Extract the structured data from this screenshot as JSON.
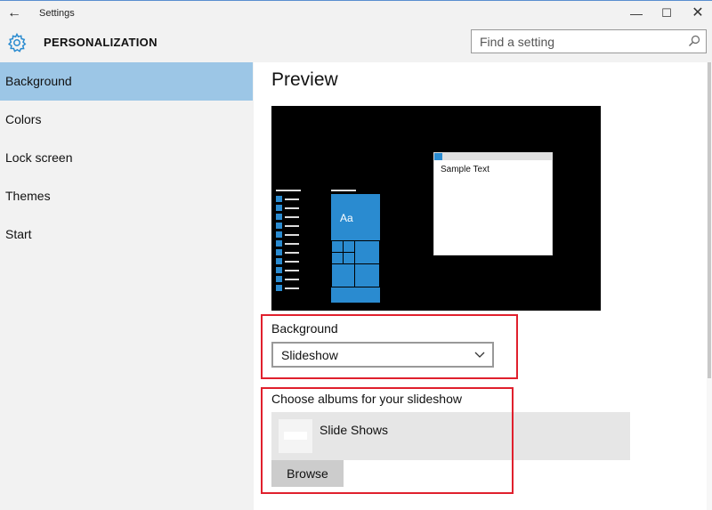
{
  "window": {
    "title": "Settings",
    "back_glyph": "←",
    "minimize_glyph": "—",
    "maximize_glyph": "☐",
    "close_glyph": "✕"
  },
  "header": {
    "section_title": "PERSONALIZATION",
    "icon": "gear-icon",
    "search": {
      "placeholder": "Find a setting",
      "value": ""
    }
  },
  "sidebar": {
    "items": [
      {
        "label": "Background",
        "active": true
      },
      {
        "label": "Colors",
        "active": false
      },
      {
        "label": "Lock screen",
        "active": false
      },
      {
        "label": "Themes",
        "active": false
      },
      {
        "label": "Start",
        "active": false
      }
    ]
  },
  "main": {
    "preview_title": "Preview",
    "preview": {
      "tile_text": "Aa",
      "window_text": "Sample Text"
    },
    "background_label": "Background",
    "background_value": "Slideshow",
    "albums_label": "Choose albums for your slideshow",
    "album_name": "Slide Shows",
    "browse_label": "Browse"
  },
  "colors": {
    "accent": "#2a8bd0",
    "selected_nav": "#9cc6e6",
    "highlight": "#e0202d"
  }
}
